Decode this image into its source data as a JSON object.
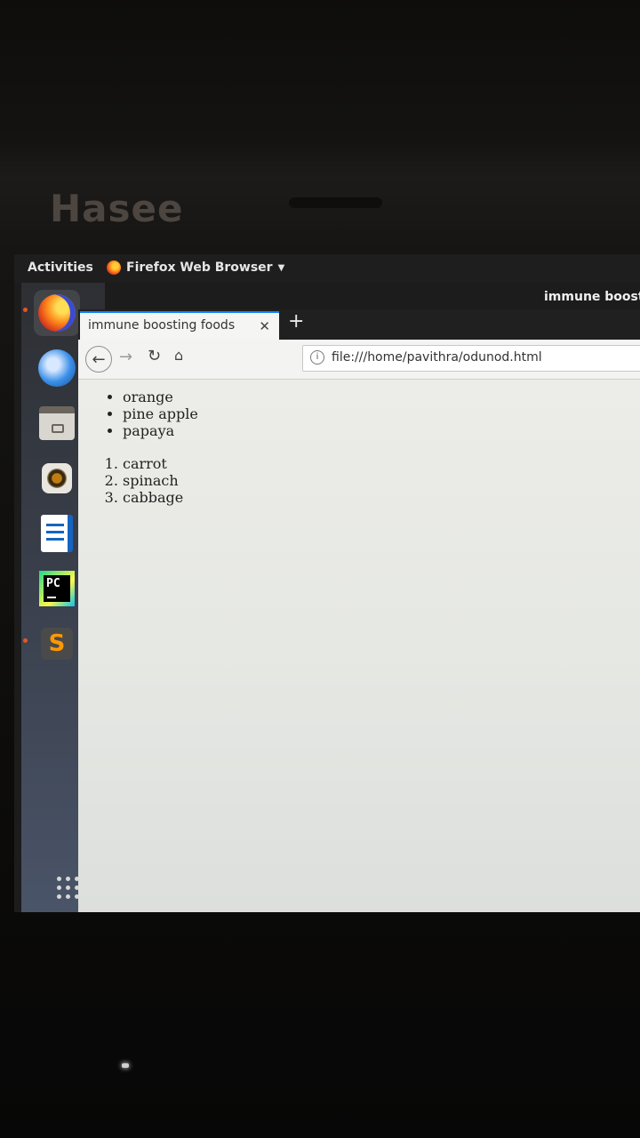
{
  "bezel": {
    "brand": "Hasee"
  },
  "topbar": {
    "activities": "Activities",
    "app_name": "Firefox Web Browser"
  },
  "window": {
    "title": "immune boost"
  },
  "browser": {
    "tab_title": "immune boosting foods",
    "url": "file:///home/pavithra/odunod.html"
  },
  "page": {
    "unordered": [
      "orange",
      "pine apple",
      "papaya"
    ],
    "ordered": [
      "carrot",
      "spinach",
      "cabbage"
    ]
  },
  "dock": {
    "items": [
      "firefox-icon",
      "thunderbird-icon",
      "files-icon",
      "rhythmbox-icon",
      "libreoffice-writer-icon",
      "pycharm-icon",
      "sublime-text-icon"
    ]
  }
}
